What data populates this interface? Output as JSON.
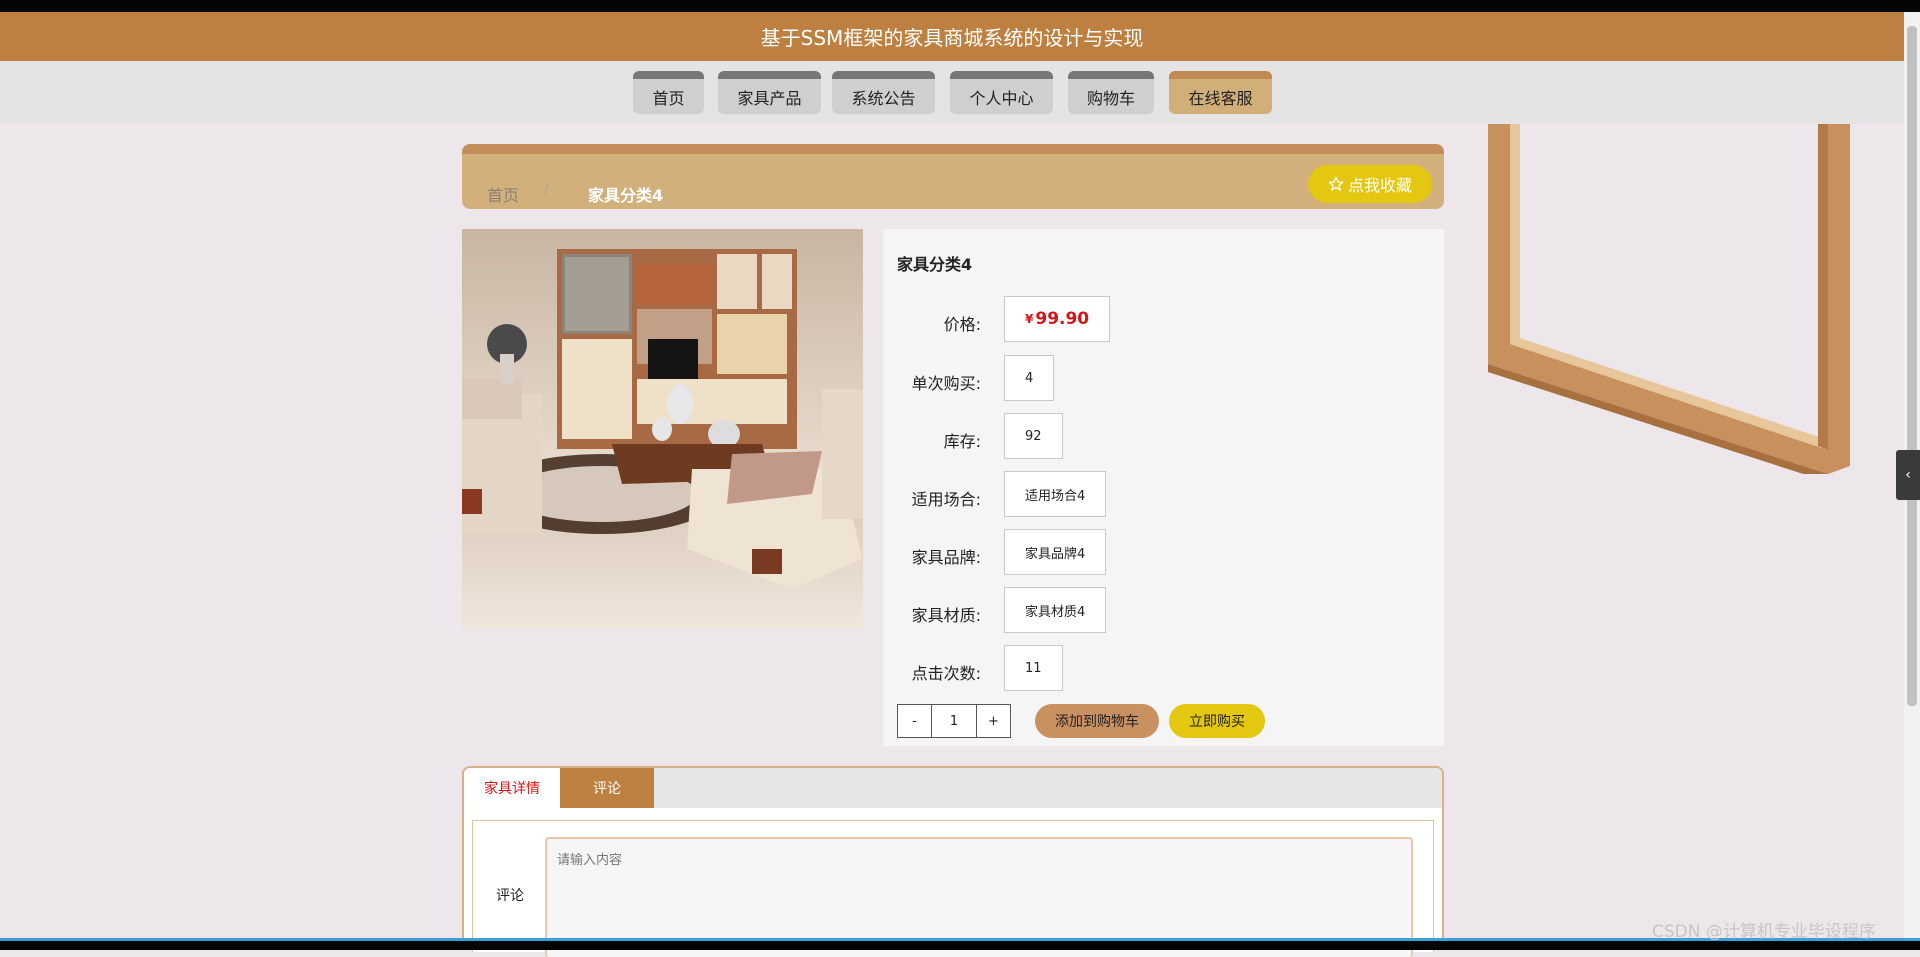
{
  "site": {
    "title": "基于SSM框架的家具商城系统的设计与实现"
  },
  "nav": {
    "items": [
      {
        "label": "首页"
      },
      {
        "label": "家具产品"
      },
      {
        "label": "系统公告"
      },
      {
        "label": "个人中心"
      },
      {
        "label": "购物车"
      },
      {
        "label": "在线客服"
      }
    ],
    "active_label": "在线客服"
  },
  "breadcrumb": {
    "home": "首页",
    "separator": "/",
    "current": "家具分类4"
  },
  "favorite": {
    "label": "点我收藏",
    "icon": "star-outline-icon"
  },
  "product": {
    "name": "家具分类4",
    "price_label": "价格:",
    "currency": "¥",
    "price": "99.90",
    "fields": [
      {
        "label": "单次购买:",
        "value": "4"
      },
      {
        "label": "库存:",
        "value": "92"
      },
      {
        "label": "适用场合:",
        "value": "适用场合4"
      },
      {
        "label": "家具品牌:",
        "value": "家具品牌4"
      },
      {
        "label": "家具材质:",
        "value": "家具材质4"
      },
      {
        "label": "点击次数:",
        "value": "11"
      }
    ],
    "quantity": {
      "minus": "-",
      "value": "1",
      "plus": "+"
    },
    "add_to_cart": "添加到购物车",
    "buy_now": "立即购买"
  },
  "tabs": [
    {
      "label": "家具详情"
    },
    {
      "label": "评论"
    }
  ],
  "comment": {
    "label": "评论",
    "placeholder": "请输入内容"
  },
  "watermark": "CSDN @计算机专业毕设程序",
  "side_tab_icon": "chevron-left-icon",
  "colors": {
    "brand": "#bd8040",
    "nav_active": "#d2ae78",
    "accent_yellow": "#e3c710",
    "price_red": "#d51515",
    "page_bg": "#ede6ea"
  }
}
